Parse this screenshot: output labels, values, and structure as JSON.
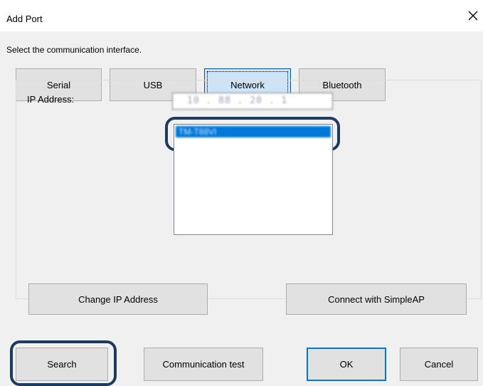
{
  "window": {
    "title": "Add Port",
    "close_icon": "close-icon"
  },
  "prompt": "Select the communication interface.",
  "interfaces": [
    {
      "label": "Serial",
      "selected": false
    },
    {
      "label": "USB",
      "selected": false
    },
    {
      "label": "Network",
      "selected": true
    },
    {
      "label": "Bluetooth",
      "selected": false
    }
  ],
  "network": {
    "ip_label": "IP Address:",
    "ip_value": "10 . 88 . 20 . 1",
    "device_list": [
      "TM-T88VI"
    ],
    "selected_index": 0,
    "change_ip_label": "Change IP Address",
    "simpleap_label": "Connect with SimpleAP"
  },
  "footer": {
    "search_label": "Search",
    "test_label": "Communication test",
    "ok_label": "OK",
    "cancel_label": "Cancel"
  },
  "colors": {
    "highlight": "#1d3b5c",
    "selected_list": "#0078d7",
    "default_button": "#0078d7"
  }
}
